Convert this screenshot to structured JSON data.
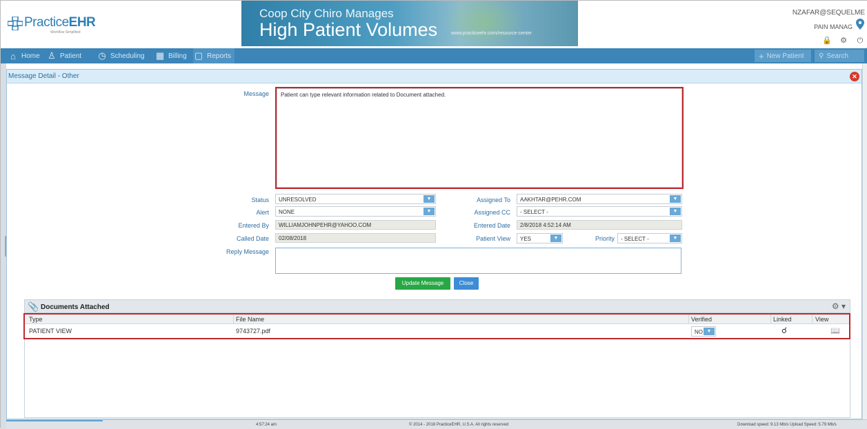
{
  "header": {
    "logo_prefix": "Practice",
    "logo_suffix": "EHR",
    "logo_tagline": "Workflow Simplified",
    "banner_line1": "Coop City Chiro Manages",
    "banner_line2": "High Patient Volumes",
    "banner_url": "www.practiceehr.com/resource-center",
    "user": "NZAFAR@SEQUELME",
    "practice": "PAIN MANAG"
  },
  "nav": {
    "home": "Home",
    "patient": "Patient",
    "scheduling": "Scheduling",
    "billing": "Billing",
    "reports": "Reports",
    "new_patient": "New Patient",
    "search": "Search"
  },
  "panel": {
    "title": "Message Detail - Other"
  },
  "form": {
    "message_label": "Message",
    "message_value": "Patient can type relevant information related to Document attached.",
    "status_label": "Status",
    "status_value": "UNRESOLVED",
    "alert_label": "Alert",
    "alert_value": "NONE",
    "entered_by_label": "Entered By",
    "entered_by_value": "WILLIAMJOHNPEHR@YAHOO.COM",
    "called_date_label": "Called Date",
    "called_date_value": "02/08/2018",
    "reply_label": "Reply Message",
    "assigned_to_label": "Assigned To",
    "assigned_to_value": "AAKHTAR@PEHR.COM",
    "assigned_cc_label": "Assigned CC",
    "assigned_cc_value": "- SELECT -",
    "entered_date_label": "Entered Date",
    "entered_date_value": "2/8/2018 4:52:14 AM",
    "patient_view_label": "Patient View",
    "patient_view_value": "YES",
    "priority_label": "Priority",
    "priority_value": "- SELECT -",
    "update_button": "Update Message",
    "close_button": "Close"
  },
  "documents": {
    "title": "Documents Attached",
    "columns": [
      "Type",
      "File Name",
      "Verified",
      "Linked",
      "View"
    ],
    "rows": [
      {
        "type": "PATIENT VIEW",
        "file_name": "9743727.pdf",
        "verified": "NO"
      }
    ]
  },
  "footer": {
    "time": "4:57:24 am",
    "copyright": "© 2014 - 2018 PracticeEHR, U.S.A. All rights reserved",
    "speed": "Download speed: 9.13 Mb/s Upload Speed: 5.79 Mb/s"
  },
  "colors": {
    "nav": "#3b85b8",
    "accent_red": "#c0272d",
    "update_green": "#28a745",
    "close_blue": "#3c8dd6"
  }
}
